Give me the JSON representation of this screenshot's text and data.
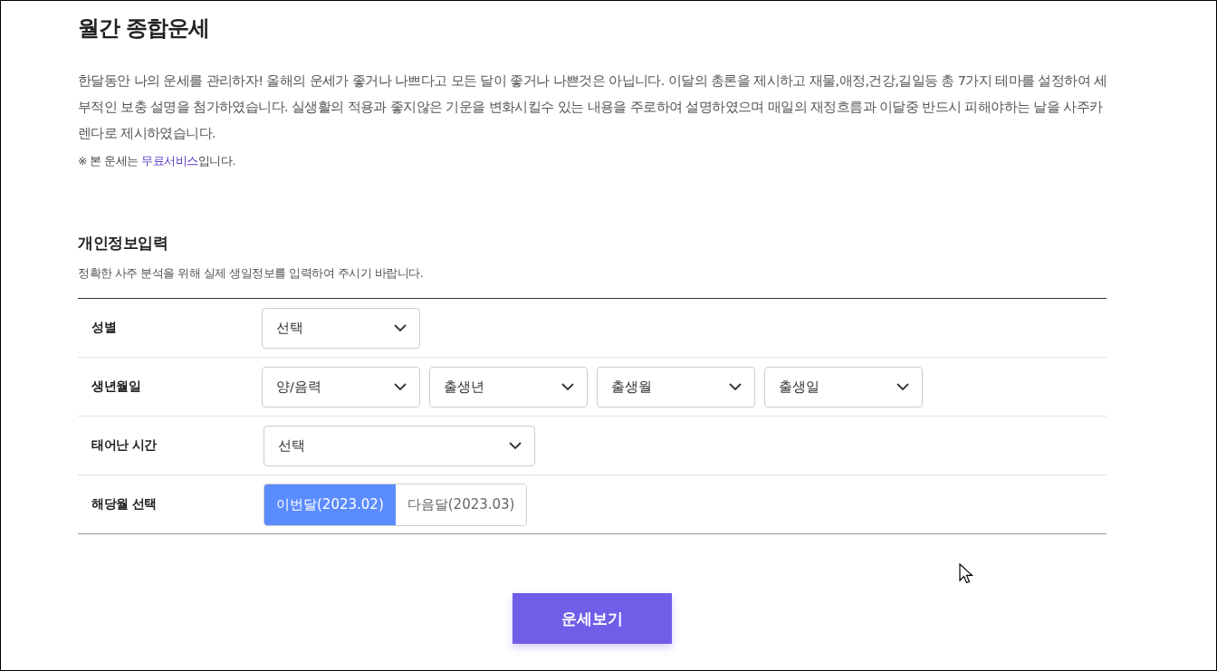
{
  "title": "월간 종합운세",
  "intro": "한달동안 나의 운세를 관리하자! 올해의 운세가 좋거나 나쁘다고 모든 달이 좋거나 나쁜것은 아닙니다. 이달의 총론을 제시하고 재물,애정,건강,길일등 총 7가지 테마를 설정하여 세부적인 보충 설명을 첨가하였습니다. 실생활의 적용과 좋지않은 기운을 변화시킬수 있는 내용을 주로하여 설명하였으며 매일의 재정흐름과 이달중 반드시 피해야하는 날을 사주카렌다로 제시하였습니다.",
  "note": {
    "before": "※ 본 운세는 ",
    "link": "무료서비스",
    "after": "입니다."
  },
  "section": {
    "heading": "개인정보입력",
    "subtitle": "정확한 사주 분석을 위해 실제 생일정보를 입력하여 주시기 바랍니다."
  },
  "form_rows": [
    {
      "label": "성별",
      "kind": "selects",
      "selects": [
        {
          "value": "선택"
        }
      ]
    },
    {
      "label": "생년월일",
      "kind": "selects",
      "selects": [
        {
          "value": "양/음력"
        },
        {
          "value": "출생년"
        },
        {
          "value": "출생월"
        },
        {
          "value": "출생일"
        }
      ]
    },
    {
      "label": "태어난 시간",
      "kind": "wide-select",
      "selects": [
        {
          "value": "선택"
        }
      ]
    },
    {
      "label": "해당월 선택",
      "kind": "toggle",
      "options": [
        {
          "label": "이번달(2023.02)",
          "selected": true
        },
        {
          "label": "다음달(2023.03)",
          "selected": false
        }
      ]
    }
  ],
  "submit": "운세보기"
}
